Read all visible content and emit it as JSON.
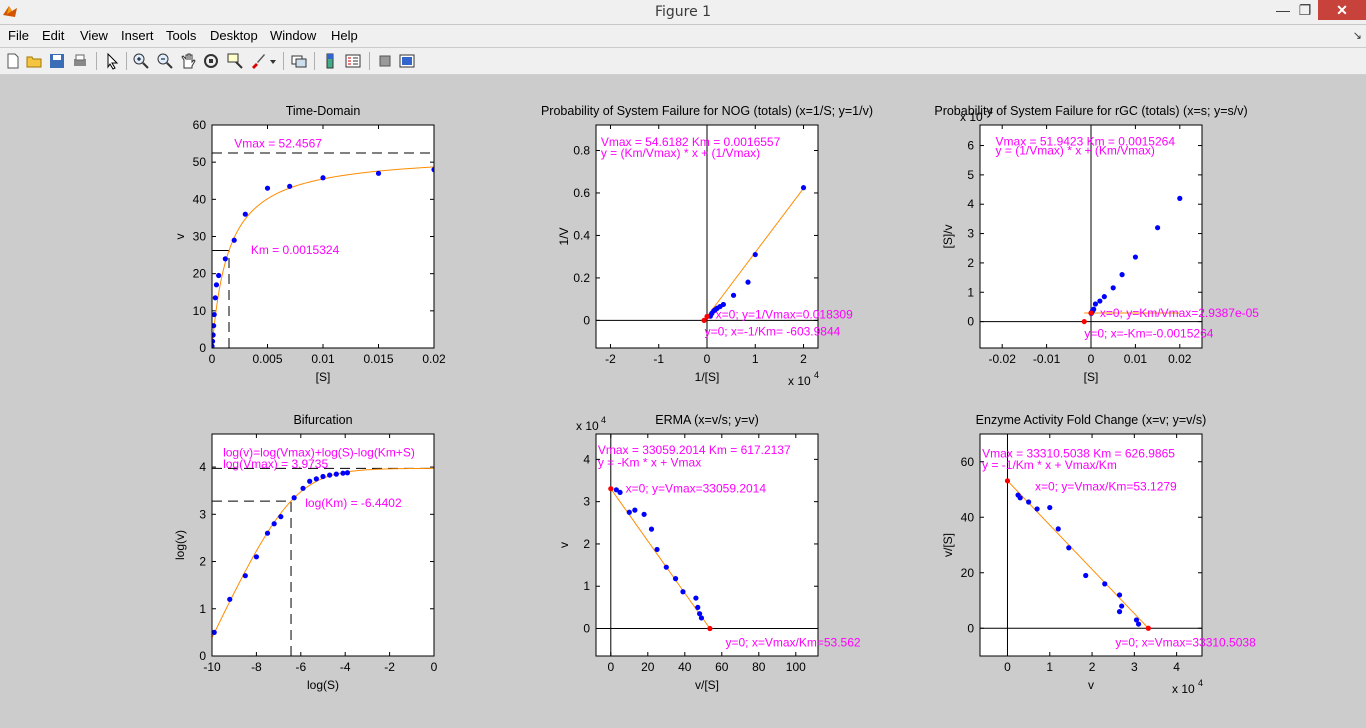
{
  "window": {
    "title": "Figure 1",
    "minimize_icon": "minimize-icon",
    "maximize_icon": "restore-icon",
    "close_icon": "close-icon"
  },
  "menu": {
    "items": [
      "File",
      "Edit",
      "View",
      "Insert",
      "Tools",
      "Desktop",
      "Window",
      "Help"
    ],
    "dock_icon": "dock-arrow-icon"
  },
  "toolbar": {
    "icons": [
      "new-figure-icon",
      "open-file-icon",
      "save-icon",
      "print-icon",
      "edit-plot-icon",
      "zoom-in-icon",
      "zoom-out-icon",
      "pan-icon",
      "rotate-3d-icon",
      "data-cursor-icon",
      "brush-icon",
      "link-plot-icon",
      "insert-colorbar-icon",
      "insert-legend-icon",
      "hide-plot-tools-icon",
      "show-plot-tools-icon"
    ]
  },
  "colors": {
    "fit_line": "#ff8c00",
    "points": "#0000ff",
    "anchor_points": "#ff0000",
    "annotation": "#ff00ff",
    "axes_bg": "#ffffff",
    "figure_bg": "#cccccc"
  },
  "chart_data": [
    {
      "type": "scatter",
      "title": "Time-Domain",
      "xlabel": "[S]",
      "ylabel": "v",
      "xlim": [
        0,
        0.02
      ],
      "ylim": [
        0,
        60
      ],
      "xticks": [
        "0",
        "0.005",
        "0.01",
        "0.015",
        "0.02"
      ],
      "yticks": [
        "0",
        "10",
        "20",
        "30",
        "40",
        "50",
        "60"
      ],
      "x_exponent": "",
      "points": [
        [
          0,
          0.5
        ],
        [
          5e-05,
          1.8
        ],
        [
          0.0001,
          3.5
        ],
        [
          0.00015,
          6
        ],
        [
          0.0002,
          9
        ],
        [
          0.0003,
          13.5
        ],
        [
          0.0004,
          17
        ],
        [
          0.0006,
          19.5
        ],
        [
          0.0012,
          24
        ],
        [
          0.002,
          29
        ],
        [
          0.003,
          36
        ],
        [
          0.005,
          43
        ],
        [
          0.007,
          43.5
        ],
        [
          0.01,
          45.8
        ],
        [
          0.015,
          47
        ],
        [
          0.02,
          48
        ]
      ],
      "fit": {
        "vmax": 52.4567,
        "km": 0.0015324,
        "model": "mm"
      },
      "guides": [
        {
          "kind": "hline",
          "y": 52.4567,
          "dash": true
        },
        {
          "kind": "hline",
          "y": 26.2284,
          "dash": false,
          "x_end": 0.0015324
        },
        {
          "kind": "vline",
          "x": 0.0015324,
          "dash": true,
          "y_end": 26.2284
        }
      ],
      "anchors": [],
      "annotations": [
        {
          "text": "Vmax = 52.4567",
          "x": 0.002,
          "y": 54
        },
        {
          "text": "Km = 0.0015324",
          "x": 0.0035,
          "y": 25.3
        }
      ]
    },
    {
      "type": "scatter",
      "title": "Probability of System Failure for NOG (totals) (x=1/S; y=1/v)",
      "xlabel": "1/[S]",
      "ylabel": "1/V",
      "xlim": [
        -2.3,
        2.3
      ],
      "ylim": [
        -0.13,
        0.92
      ],
      "xticks": [
        "-2",
        "-1",
        "0",
        "1",
        "2"
      ],
      "yticks": [
        "0",
        "0.2",
        "0.4",
        "0.6",
        "0.8"
      ],
      "x_exponent": "x 10",
      "x_exponent_power": "4",
      "points": [
        [
          0.05,
          0.02
        ],
        [
          0.1,
          0.03
        ],
        [
          0.15,
          0.04
        ],
        [
          0.2,
          0.05
        ],
        [
          0.25,
          0.055
        ],
        [
          0.3,
          0.065
        ],
        [
          0.4,
          0.08
        ],
        [
          0.7,
          0.12
        ],
        [
          1.1,
          0.18
        ],
        [
          2.0,
          0.315
        ],
        [
          2.0,
          0.625
        ]
      ],
      "points_override": [
        [
          0.07,
          0.02
        ],
        [
          0.1,
          0.033
        ],
        [
          0.14,
          0.045
        ],
        [
          0.17,
          0.05
        ],
        [
          0.21,
          0.057
        ],
        [
          0.27,
          0.065
        ],
        [
          0.34,
          0.075
        ],
        [
          0.55,
          0.118
        ],
        [
          0.85,
          0.18
        ],
        [
          1.0,
          0.31
        ],
        [
          2.0,
          0.625
        ]
      ],
      "fit": {
        "slope": 0.3019,
        "intercept": 0.018309,
        "model": "line",
        "x_from": -0.0604,
        "x_to": 2.0
      },
      "guides": [
        {
          "kind": "hline",
          "y": 0
        },
        {
          "kind": "vline",
          "x": 0
        }
      ],
      "anchors": [
        [
          0,
          0.018309
        ],
        [
          -0.0604,
          0
        ]
      ],
      "annotations": [
        {
          "text": "Vmax = 54.6182   Km = 0.0016557",
          "x": -2.2,
          "y": 0.82
        },
        {
          "text": "y = (Km/Vmax) * x + (1/Vmax)",
          "x": -2.2,
          "y": 0.77
        },
        {
          "text": "x=0; y=1/Vmax=0.018309",
          "x": 0.18,
          "y": 0.01
        },
        {
          "text": "y=0; x=-1/Km= -603.9844",
          "x": -0.05,
          "y": -0.07
        }
      ]
    },
    {
      "type": "scatter",
      "title": "Probability of System Failure for rGC (totals) (x=s; y=s/v)",
      "xlabel": "[S]",
      "ylabel": "[S]/v",
      "xlim": [
        -0.025,
        0.025
      ],
      "ylim": [
        -0.9,
        6.7
      ],
      "xticks": [
        "-0.02",
        "-0.01",
        "0",
        "0.01",
        "0.02"
      ],
      "yticks": [
        "0",
        "1",
        "2",
        "3",
        "4",
        "5",
        "6"
      ],
      "y_exponent": "x 10",
      "y_exponent_power": "-4",
      "points": [
        [
          5e-05,
          0.28
        ],
        [
          0.0001,
          0.3
        ],
        [
          0.0002,
          0.32
        ],
        [
          0.0003,
          0.35
        ],
        [
          0.0004,
          0.4
        ],
        [
          0.0006,
          0.42
        ],
        [
          0.001,
          0.6
        ],
        [
          0.002,
          0.7
        ],
        [
          0.003,
          0.85
        ],
        [
          0.005,
          1.15
        ],
        [
          0.007,
          1.6
        ],
        [
          0.01,
          2.2
        ],
        [
          0.015,
          3.2
        ],
        [
          0.02,
          4.2
        ]
      ],
      "fit": {
        "slope": 0.01926,
        "intercept": 0.29387,
        "model": "line",
        "x_from": -0.0015264,
        "x_to": 0.02
      },
      "guides": [
        {
          "kind": "hline",
          "y": 0
        },
        {
          "kind": "vline",
          "x": 0
        }
      ],
      "anchors": [
        [
          0,
          0.29387
        ],
        [
          -0.0015264,
          0
        ]
      ],
      "annotations": [
        {
          "text": "Vmax = 51.9423   Km = 0.0015264",
          "x": -0.0215,
          "y": 6.0
        },
        {
          "text": "y = (1/Vmax) * x + (Km/Vmax)",
          "x": -0.0215,
          "y": 5.7
        },
        {
          "text": "x=0; y=Km/Vmax=2.9387e-05",
          "x": 0.002,
          "y": 0.15
        },
        {
          "text": "y=0; x=-Km=-0.0015264",
          "x": -0.0015,
          "y": -0.55
        }
      ]
    },
    {
      "type": "scatter",
      "title": "Bifurcation",
      "xlabel": "log(S)",
      "ylabel": "log(v)",
      "xlim": [
        -10,
        0
      ],
      "ylim": [
        0,
        4.7
      ],
      "xticks": [
        "-10",
        "-8",
        "-6",
        "-4",
        "-2",
        "0"
      ],
      "yticks": [
        "0",
        "1",
        "2",
        "3",
        "4"
      ],
      "points": [
        [
          -9.9,
          0.5
        ],
        [
          -9.2,
          1.2
        ],
        [
          -8.5,
          1.7
        ],
        [
          -8.0,
          2.1
        ],
        [
          -7.5,
          2.6
        ],
        [
          -7.2,
          2.8
        ],
        [
          -6.9,
          2.95
        ],
        [
          -6.3,
          3.35
        ],
        [
          -5.9,
          3.55
        ],
        [
          -5.6,
          3.7
        ],
        [
          -5.3,
          3.75
        ],
        [
          -5.0,
          3.8
        ],
        [
          -4.7,
          3.83
        ],
        [
          -4.4,
          3.85
        ],
        [
          -4.1,
          3.87
        ],
        [
          -3.9,
          3.88
        ]
      ],
      "fit": {
        "logvmax": 3.9735,
        "logkm": -6.4402,
        "model": "bif"
      },
      "guides": [
        {
          "kind": "hline",
          "y": 3.9735,
          "dash": true
        },
        {
          "kind": "hline",
          "y": 3.28,
          "dash": true,
          "x_end": -6.4402
        },
        {
          "kind": "vline",
          "x": -6.4402,
          "dash": true,
          "y_end": 3.28
        }
      ],
      "anchors": [],
      "annotations": [
        {
          "text": "log(v)=log(Vmax)+log(S)-log(Km+S)",
          "x": -9.5,
          "y": 4.22
        },
        {
          "text": "log(Vmax) = 3.9735",
          "x": -9.5,
          "y": 3.98
        },
        {
          "text": "log(Km) = -6.4402",
          "x": -5.8,
          "y": 3.15
        }
      ]
    },
    {
      "type": "scatter",
      "title": "ERMA (x=v/s; y=v)",
      "xlabel": "v/[S]",
      "ylabel": "v",
      "xlim": [
        -8,
        112
      ],
      "ylim": [
        -0.65,
        4.6
      ],
      "xticks": [
        "0",
        "20",
        "40",
        "60",
        "80",
        "100"
      ],
      "yticks": [
        "0",
        "1",
        "2",
        "3",
        "4"
      ],
      "y_exponent": "x 10",
      "y_exponent_power": "4",
      "points": [
        [
          3,
          3.28
        ],
        [
          5,
          3.22
        ],
        [
          10,
          2.75
        ],
        [
          13,
          2.8
        ],
        [
          18,
          2.7
        ],
        [
          22,
          2.35
        ],
        [
          25,
          1.87
        ],
        [
          30,
          1.45
        ],
        [
          35,
          1.18
        ],
        [
          39,
          0.87
        ],
        [
          46,
          0.72
        ],
        [
          47,
          0.5
        ],
        [
          48,
          0.35
        ],
        [
          49,
          0.25
        ]
      ],
      "fit": {
        "slope": -617.2137,
        "intercept": 33059.2014,
        "model": "line_scaled",
        "scale": 10000,
        "x_from": 0,
        "x_to": 53.562
      },
      "guides": [
        {
          "kind": "hline",
          "y": 0
        },
        {
          "kind": "vline",
          "x": 0
        }
      ],
      "anchors": [
        [
          0,
          3.30592
        ],
        [
          53.562,
          0
        ]
      ],
      "annotations": [
        {
          "text": "Vmax = 33059.2014      Km = 617.2137",
          "x": -7,
          "y": 4.13
        },
        {
          "text": "y = -Km * x + Vmax",
          "x": -7,
          "y": 3.83
        },
        {
          "text": "x=0; y=Vmax=33059.2014",
          "x": 8,
          "y": 3.22
        },
        {
          "text": "y=0; x=Vmax/Km=53.562",
          "x": 62,
          "y": -0.43
        }
      ]
    },
    {
      "type": "scatter",
      "title": "Enzyme Activity Fold Change (x=v; y=v/s)",
      "xlabel": "v",
      "ylabel": "v/[S]",
      "xlim": [
        -0.65,
        4.6
      ],
      "ylim": [
        -10,
        70
      ],
      "xticks": [
        "0",
        "1",
        "2",
        "3",
        "4"
      ],
      "yticks": [
        "0",
        "20",
        "40",
        "60"
      ],
      "x_exponent": "x 10",
      "x_exponent_power": "4",
      "points": [
        [
          0.25,
          48
        ],
        [
          0.3,
          47
        ],
        [
          0.5,
          45.5
        ],
        [
          0.7,
          43
        ],
        [
          1.0,
          43.5
        ],
        [
          1.2,
          35.8
        ],
        [
          1.45,
          29
        ],
        [
          1.85,
          19
        ],
        [
          2.3,
          16
        ],
        [
          2.65,
          12
        ],
        [
          2.65,
          6
        ],
        [
          2.7,
          8
        ],
        [
          3.05,
          3
        ],
        [
          3.1,
          1.5
        ]
      ],
      "fit": {
        "slope": -1.6012,
        "intercept": 53.1279,
        "model": "line_scaled_x",
        "x_from": 0,
        "x_to": 3.33105
      },
      "guides": [
        {
          "kind": "hline",
          "y": 0
        },
        {
          "kind": "vline",
          "x": 0
        }
      ],
      "anchors": [
        [
          0,
          53.1279
        ],
        [
          3.33105,
          0
        ]
      ],
      "annotations": [
        {
          "text": "Vmax = 33310.5038    Km = 626.9865",
          "x": -0.6,
          "y": 61.5
        },
        {
          "text": "y = -1/Km * x + Vmax/Km",
          "x": -0.6,
          "y": 57.3
        },
        {
          "text": "x=0; y=Vmax/Km=53.1279",
          "x": 0.65,
          "y": 49.6
        },
        {
          "text": "y=0; x=Vmax=33310.5038",
          "x": 2.55,
          "y": -6.6
        }
      ]
    }
  ]
}
